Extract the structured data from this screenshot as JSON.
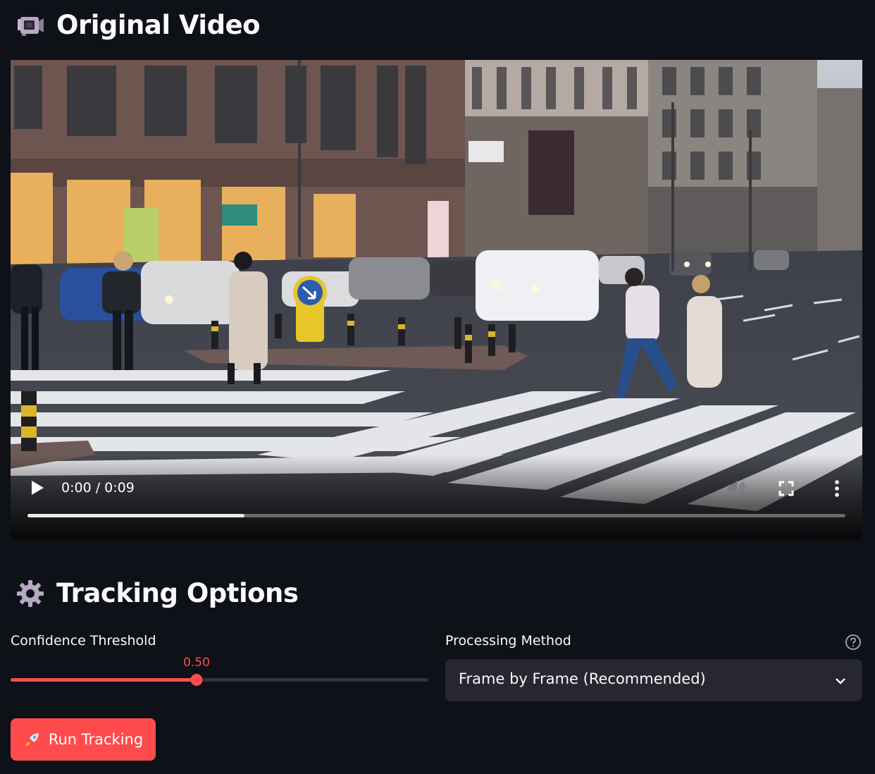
{
  "video_section": {
    "title": "Original Video",
    "icon": "video-camera-icon"
  },
  "video_player": {
    "time": "0:00 / 0:09",
    "buffered_fraction": 0.265,
    "icons": [
      "play-icon",
      "mute-icon",
      "fullscreen-icon",
      "more-options-icon"
    ]
  },
  "tracking_section": {
    "title": "Tracking Options",
    "icon": "gear-icon"
  },
  "confidence": {
    "label": "Confidence Threshold",
    "value_text": "0.50",
    "value": 0.5,
    "min": 0,
    "max": 1
  },
  "processing": {
    "label": "Processing Method",
    "selected": "Frame by Frame (Recommended)",
    "help_icon": "help-circle-icon"
  },
  "run_button": {
    "label": "Run Tracking",
    "icon": "rocket-icon"
  },
  "colors": {
    "background": "#0e1117",
    "accent": "#ff4b4b",
    "widget_bg": "#262730"
  }
}
